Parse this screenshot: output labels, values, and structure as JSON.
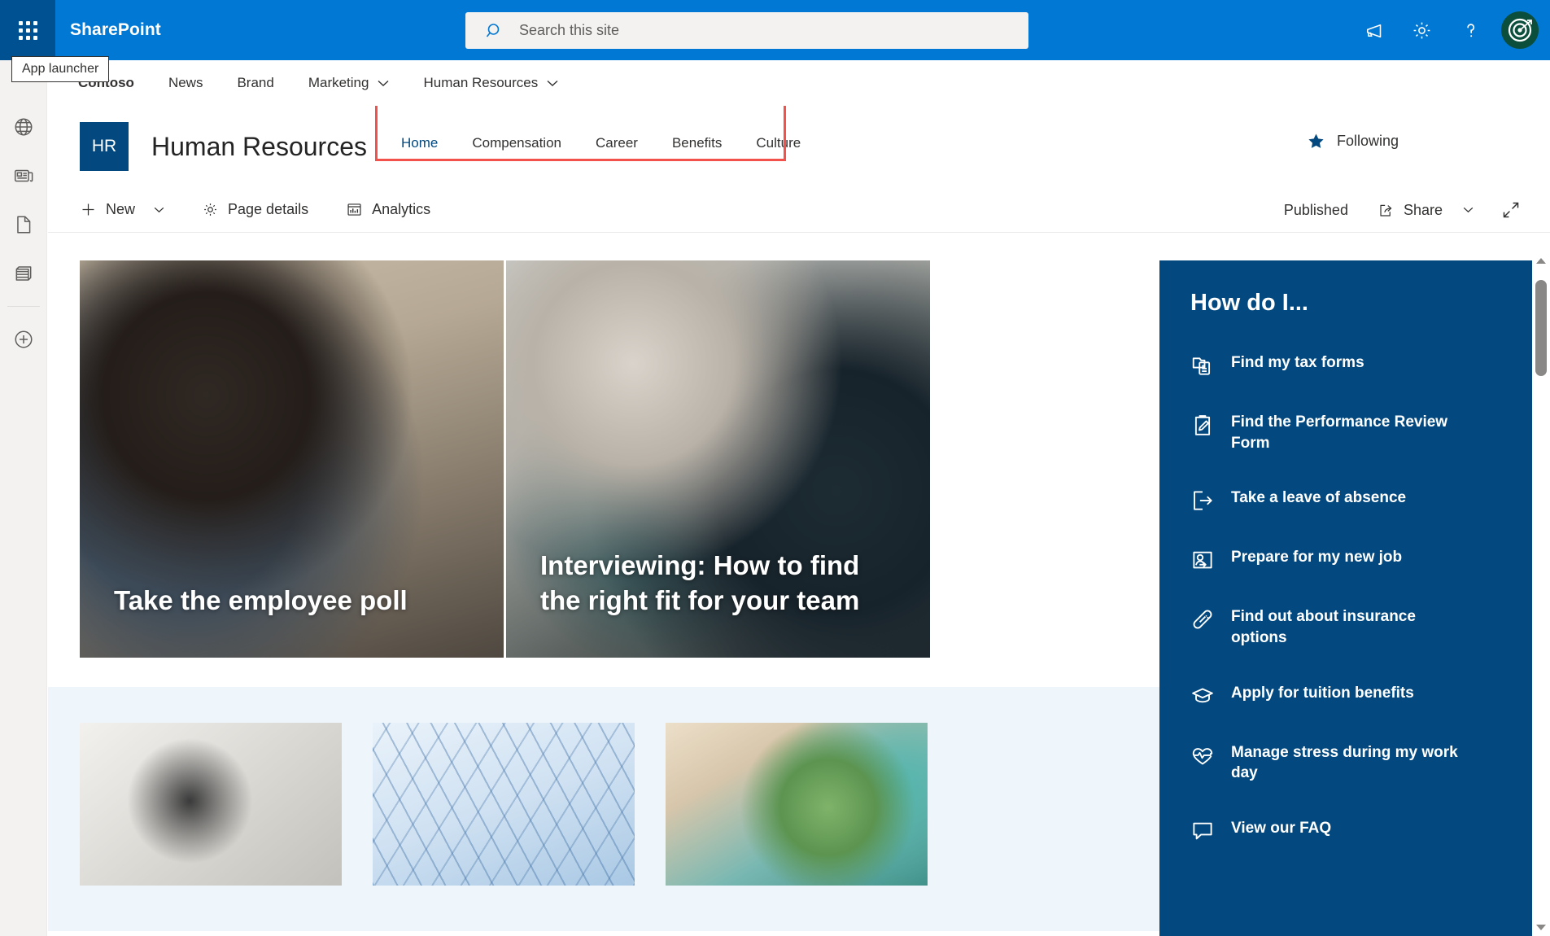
{
  "suite": {
    "brand": "SharePoint",
    "waffle_tooltip": "App launcher",
    "search_placeholder": "Search this site",
    "search_value": "",
    "icons": [
      "megaphone-icon",
      "gear-icon",
      "help-icon",
      "avatar"
    ]
  },
  "hub_nav": {
    "items": [
      {
        "label": "Contoso",
        "has_chevron": false
      },
      {
        "label": "News",
        "has_chevron": false
      },
      {
        "label": "Brand",
        "has_chevron": false
      },
      {
        "label": "Marketing",
        "has_chevron": true
      },
      {
        "label": "Human Resources",
        "has_chevron": true
      }
    ]
  },
  "left_rail": {
    "items": [
      "globe-icon",
      "news-icon",
      "page-icon",
      "list-icon",
      "add-icon"
    ]
  },
  "site": {
    "logo_text": "HR",
    "title": "Human Resources",
    "following_label": "Following",
    "nav": [
      {
        "label": "Home",
        "active": true
      },
      {
        "label": "Compensation",
        "active": false
      },
      {
        "label": "Career",
        "active": false
      },
      {
        "label": "Benefits",
        "active": false
      },
      {
        "label": "Culture",
        "active": false
      }
    ]
  },
  "command_bar": {
    "new_label": "New",
    "page_details_label": "Page details",
    "analytics_label": "Analytics",
    "published_label": "Published",
    "share_label": "Share",
    "expand_icon": "expand-icon"
  },
  "hero": {
    "cards": [
      {
        "title": "Take the employee poll",
        "image": "img-a"
      },
      {
        "title": "Interviewing: How to find the right fit for your team",
        "image": "img-b"
      }
    ]
  },
  "lower_cards": [
    {
      "image": "img-c"
    },
    {
      "image": "img-d"
    },
    {
      "image": "img-e"
    }
  ],
  "how_do_i": {
    "title": "How do I...",
    "items": [
      {
        "label": "Find my tax forms",
        "icon": "tax-forms-icon"
      },
      {
        "label": "Find the Performance Review Form",
        "icon": "clipboard-edit-icon"
      },
      {
        "label": "Take a leave of absence",
        "icon": "exit-icon"
      },
      {
        "label": "Prepare for my new job",
        "icon": "new-hire-icon"
      },
      {
        "label": "Find out about insurance options",
        "icon": "bandage-icon"
      },
      {
        "label": "Apply for tuition benefits",
        "icon": "graduation-cap-icon"
      },
      {
        "label": "Manage stress during my work day",
        "icon": "heartbeat-icon"
      },
      {
        "label": "View our FAQ",
        "icon": "faq-icon"
      }
    ]
  },
  "colors": {
    "suite_blue": "#0078d4",
    "waffle_blue": "#005191",
    "site_blue": "#03497f",
    "highlight_red": "#f2524b",
    "lower_bg": "#eff6fb"
  }
}
